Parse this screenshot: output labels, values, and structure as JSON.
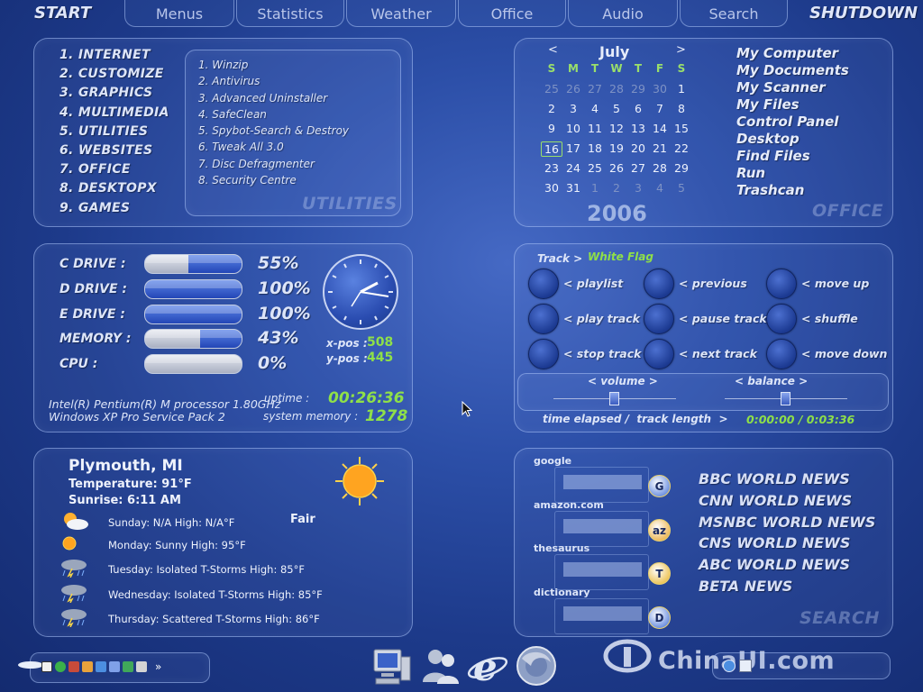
{
  "topbar": {
    "start": "START",
    "shutdown": "SHUTDOWN",
    "tabs": [
      "Menus",
      "Statistics",
      "Weather",
      "Office",
      "Audio",
      "Search"
    ]
  },
  "menu": {
    "items": [
      "1.  INTERNET",
      "2.  CUSTOMIZE",
      "3.  GRAPHICS",
      "4.  MULTIMEDIA",
      "5.  UTILITIES",
      "6.  WEBSITES",
      "7.  OFFICE",
      "8.  DESKTOPX",
      "9.  GAMES"
    ],
    "utilities": [
      "1.  Winzip",
      "2.  Antivirus",
      "3.  Advanced Uninstaller",
      "4.  SafeClean",
      "5.  Spybot-Search & Destroy",
      "6.  Tweak All 3.0",
      "7.  Disc Defragmenter",
      "8.  Security Centre"
    ],
    "utilities_watermark": "UTILITIES"
  },
  "calendar": {
    "prev": "<",
    "next": ">",
    "month": "July",
    "year": "2006",
    "weekdays": [
      "S",
      "M",
      "T",
      "W",
      "T",
      "F",
      "S"
    ],
    "weeks": [
      [
        "25",
        "26",
        "27",
        "28",
        "29",
        "30",
        "1"
      ],
      [
        "2",
        "3",
        "4",
        "5",
        "6",
        "7",
        "8"
      ],
      [
        "9",
        "10",
        "11",
        "12",
        "13",
        "14",
        "15"
      ],
      [
        "16",
        "17",
        "18",
        "19",
        "20",
        "21",
        "22"
      ],
      [
        "23",
        "24",
        "25",
        "26",
        "27",
        "28",
        "29"
      ],
      [
        "30",
        "31",
        "1",
        "2",
        "3",
        "4",
        "5"
      ]
    ],
    "today": "16"
  },
  "office": {
    "links": [
      "My Computer",
      "My Documents",
      "My Scanner",
      "My Files",
      "Control Panel",
      "Desktop",
      "Find Files",
      "Run",
      "Trashcan"
    ],
    "watermark": "OFFICE"
  },
  "stats": {
    "drives": [
      {
        "label": "C DRIVE :",
        "value": "55%",
        "fill": 0.55
      },
      {
        "label": "D DRIVE :",
        "value": "100%",
        "fill": 1.0
      },
      {
        "label": "E DRIVE :",
        "value": "100%",
        "fill": 1.0
      },
      {
        "label": "MEMORY :",
        "value": "43%",
        "fill": 0.43
      },
      {
        "label": "CPU :",
        "value": "0%",
        "fill": 0.0
      }
    ],
    "xpos_label": "x-pos :",
    "xpos": "508",
    "ypos_label": "y-pos :",
    "ypos": "445",
    "processor": "Intel(R) Pentium(R) M processor 1.80GHz",
    "os": "Windows XP Pro Service Pack 2",
    "uptime_label": "uptime :",
    "uptime": "00:26:36",
    "sysmem_label": "system memory :",
    "sysmem": "1278"
  },
  "audio": {
    "track_label": "Track >",
    "track": "White Flag",
    "buttons": [
      "< playlist",
      "< previous",
      "< move up",
      "< play track",
      "< pause track",
      "< shuffle",
      "< stop track",
      "< next track",
      "< move down"
    ],
    "volume": "< volume >",
    "balance": "< balance >",
    "time_label": "time elapsed /  track length  >",
    "time": "0:00:00 / 0:03:36"
  },
  "weather": {
    "city": "Plymouth, MI",
    "temperature": "Temperature: 91°F",
    "sunrise": "Sunrise: 6:11 AM",
    "condition": "Fair",
    "forecast": [
      {
        "icon": "partly-cloudy-icon",
        "text": "Sunday: N/A High: N/A°F"
      },
      {
        "icon": "sun-icon",
        "text": "Monday: Sunny High: 95°F"
      },
      {
        "icon": "storm-icon",
        "text": "Tuesday: Isolated T-Storms High: 85°F"
      },
      {
        "icon": "storm-icon",
        "text": "Wednesday: Isolated T-Storms High: 85°F"
      },
      {
        "icon": "storm-icon",
        "text": "Thursday: Scattered T-Storms High: 86°F"
      }
    ]
  },
  "search": {
    "engines": [
      {
        "label": "google",
        "go": "G"
      },
      {
        "label": "amazon.com",
        "go": "az"
      },
      {
        "label": "thesaurus",
        "go": "T"
      },
      {
        "label": "dictionary",
        "go": "D"
      }
    ],
    "news": [
      "BBC WORLD NEWS",
      "CNN WORLD NEWS",
      "MSNBC WORLD NEWS",
      "CNS WORLD NEWS",
      "ABC WORLD NEWS",
      "BETA NEWS"
    ],
    "watermark": "SEARCH"
  },
  "branding": {
    "logo": "ChinaUI.com"
  },
  "taskbar": {
    "more": "»"
  }
}
